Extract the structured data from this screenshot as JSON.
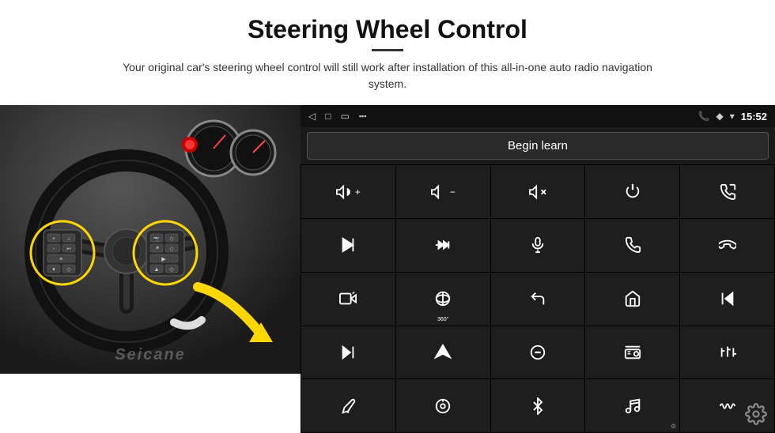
{
  "header": {
    "title": "Steering Wheel Control",
    "divider": true,
    "subtitle": "Your original car's steering wheel control will still work after installation of this all-in-one auto radio navigation system."
  },
  "android_panel": {
    "status_bar": {
      "back_icon": "◁",
      "home_icon": "□",
      "recent_icon": "▱",
      "signal_icon": "▪▪",
      "phone_icon": "📞",
      "location_icon": "◆",
      "wifi_icon": "▾",
      "time": "15:52"
    },
    "begin_learn_label": "Begin learn",
    "controls": [
      {
        "icon": "vol_up",
        "label": "🔊+"
      },
      {
        "icon": "vol_down",
        "label": "🔉-"
      },
      {
        "icon": "vol_mute",
        "label": "🔇x"
      },
      {
        "icon": "power",
        "label": "⏻"
      },
      {
        "icon": "prev_track",
        "label": "⏮"
      },
      {
        "icon": "skip_next",
        "label": "⏭"
      },
      {
        "icon": "ff_next",
        "label": "⏩"
      },
      {
        "icon": "mic",
        "label": "🎤"
      },
      {
        "icon": "phone",
        "label": "📞"
      },
      {
        "icon": "hang_up",
        "label": "📵"
      },
      {
        "icon": "cam",
        "label": "📷"
      },
      {
        "icon": "360",
        "label": "360°"
      },
      {
        "icon": "back",
        "label": "↩"
      },
      {
        "icon": "home",
        "label": "⌂"
      },
      {
        "icon": "rew",
        "label": "⏮"
      },
      {
        "icon": "ff2",
        "label": "⏭"
      },
      {
        "icon": "nav",
        "label": "▲"
      },
      {
        "icon": "source",
        "label": "⊖"
      },
      {
        "icon": "radio",
        "label": "📻"
      },
      {
        "icon": "eq",
        "label": "⚙"
      },
      {
        "icon": "pen",
        "label": "✏"
      },
      {
        "icon": "knob",
        "label": "⊙"
      },
      {
        "icon": "bt",
        "label": "✦"
      },
      {
        "icon": "music",
        "label": "♪"
      },
      {
        "icon": "wave",
        "label": "≋"
      }
    ],
    "settings_icon": "⚙",
    "watermark": "Seicane"
  }
}
